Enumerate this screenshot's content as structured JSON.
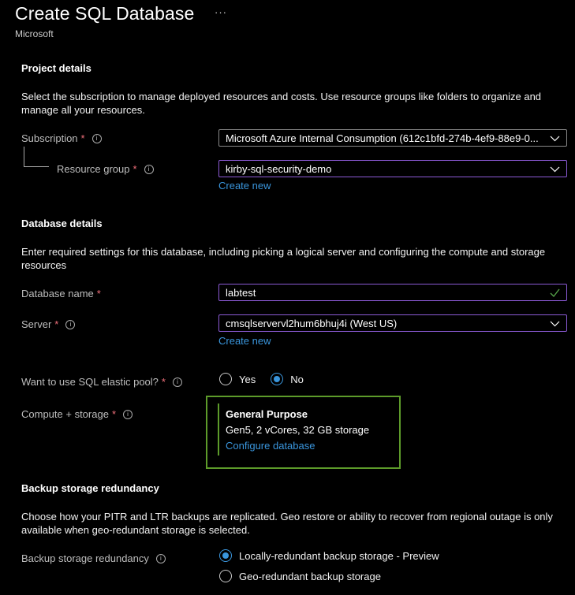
{
  "header": {
    "title": "Create SQL Database",
    "more": "···",
    "publisher": "Microsoft"
  },
  "project": {
    "heading": "Project details",
    "description": "Select the subscription to manage deployed resources and costs. Use resource groups like folders to organize and manage all your resources.",
    "subscription": {
      "label": "Subscription",
      "value": "Microsoft Azure Internal Consumption (612c1bfd-274b-4ef9-88e9-0..."
    },
    "resource_group": {
      "label": "Resource group",
      "value": "kirby-sql-security-demo",
      "create_new": "Create new"
    }
  },
  "database": {
    "heading": "Database details",
    "description": "Enter required settings for this database, including picking a logical server and configuring the compute and storage resources",
    "name": {
      "label": "Database name",
      "value": "labtest"
    },
    "server": {
      "label": "Server",
      "value": "cmsqlservervl2hum6bhuj4i (West US)",
      "create_new": "Create new"
    },
    "elastic_pool": {
      "label": "Want to use SQL elastic pool?",
      "options": [
        "Yes",
        "No"
      ],
      "selected": "No"
    },
    "compute": {
      "label": "Compute + storage",
      "tier": "General Purpose",
      "spec": "Gen5, 2 vCores, 32 GB storage",
      "configure": "Configure database"
    }
  },
  "backup": {
    "heading": "Backup storage redundancy",
    "description": "Choose how your PITR and LTR backups are replicated. Geo restore or ability to recover from regional outage is only available when geo-redundant storage is selected.",
    "label": "Backup storage redundancy",
    "options": [
      "Locally-redundant backup storage - Preview",
      "Geo-redundant backup storage"
    ],
    "selected": "Locally-redundant backup storage - Preview"
  },
  "colors": {
    "accent": "#3a96dd",
    "required": "#f1707b",
    "field_focus": "#8c5bd6",
    "highlight": "#5d9b2a",
    "valid": "#57a64a"
  }
}
